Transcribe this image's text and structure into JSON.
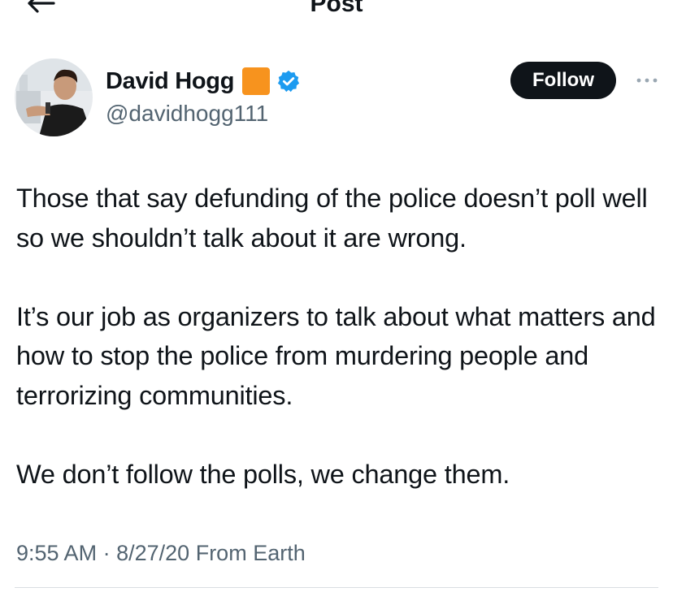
{
  "header": {
    "title": "Post",
    "back_icon": "back-arrow-icon"
  },
  "author": {
    "display_name": "David Hogg",
    "handle": "@davidhogg111",
    "emoji": "orange-square",
    "verified": true,
    "verified_color": "#1d9bf0"
  },
  "actions": {
    "follow_label": "Follow",
    "more_icon": "more-options-icon"
  },
  "tweet": {
    "paragraphs": [
      "Those that say defunding of the police doesn’t poll well so we shouldn’t talk about it are wrong.",
      "It’s our job as organizers to talk about what matters and how to stop the police from murdering people and terrorizing communities.",
      "We don’t follow the polls, we change them."
    ]
  },
  "meta": {
    "time": "9:55 AM",
    "separator": "·",
    "date": "8/27/20",
    "source": "From Earth"
  },
  "colors": {
    "text": "#0f1419",
    "secondary": "#536471",
    "follow_bg": "#0f1419",
    "emoji_orange": "#f7931e"
  }
}
